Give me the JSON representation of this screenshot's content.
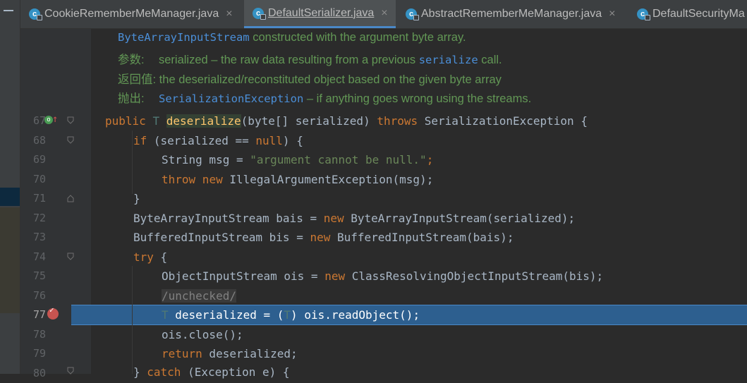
{
  "tabs": [
    {
      "label": "CookieRememberMeManager.java",
      "active": false,
      "icon": "class-icon"
    },
    {
      "label": "DefaultSerializer.java",
      "active": true,
      "icon": "class-icon"
    },
    {
      "label": "AbstractRememberMeManager.java",
      "active": false,
      "icon": "class-icon"
    },
    {
      "label": "DefaultSecurityMa",
      "active": false,
      "icon": "class-icon"
    }
  ],
  "close_glyph": "×",
  "doc": {
    "line1_code": "ByteArrayInputStream",
    "line1_text": " constructed with the argument byte array.",
    "params_tag": "参数:",
    "params_text": "serialized – the raw data resulting from a previous ",
    "params_code": "serialize",
    "params_tail": " call.",
    "returns_tag": "返回值:",
    "returns_text": " the deserialized/reconstituted object based on the given byte array",
    "throws_tag": "抛出:",
    "throws_code": "SerializationException",
    "throws_text": " – if anything goes wrong using the streams."
  },
  "line_numbers": [
    "67",
    "68",
    "69",
    "70",
    "71",
    "72",
    "73",
    "74",
    "75",
    "76",
    "77",
    "78",
    "79",
    "80"
  ],
  "code": {
    "l67_a": "public ",
    "l67_t": "T ",
    "l67_fn": "deserialize",
    "l67_b": "(byte[] serialized) ",
    "l67_kw": "throws",
    "l67_c": " SerializationException {",
    "l68_kw": "if",
    "l68_a": " (serialized == ",
    "l68_null": "null",
    "l68_b": ") {",
    "l69_a": "String msg = ",
    "l69_str": "\"argument cannot be null.\"",
    "l69_b": ";",
    "l70_kw1": "throw",
    "l70_kw2": " new",
    "l70_a": " IllegalArgumentException(msg);",
    "l71": "}",
    "l72_a": "ByteArrayInputStream bais = ",
    "l72_kw": "new",
    "l72_b": " ByteArrayInputStream(serialized);",
    "l73_a": "BufferedInputStream bis = ",
    "l73_kw": "new",
    "l73_b": " BufferedInputStream(bais);",
    "l74_kw": "try",
    "l74_a": " {",
    "l75_a": "ObjectInputStream ois = ",
    "l75_kw": "new",
    "l75_b": " ClassResolvingObjectInputStream(bis);",
    "l76_cmt": "/unchecked/",
    "l77_t": "T",
    "l77_a": " deserialized = (",
    "l77_t2": "T",
    "l77_b": ") ois.readObject();",
    "l78": "ois.close();",
    "l79_kw": "return",
    "l79_a": " deserialized;",
    "l80_a": "} ",
    "l80_kw": "catch",
    "l80_b": " (Exception e) {"
  },
  "colors": {
    "keyword": "#cc7832",
    "string": "#6a8759",
    "doc": "#629755",
    "selection": "#2d5f8f"
  }
}
